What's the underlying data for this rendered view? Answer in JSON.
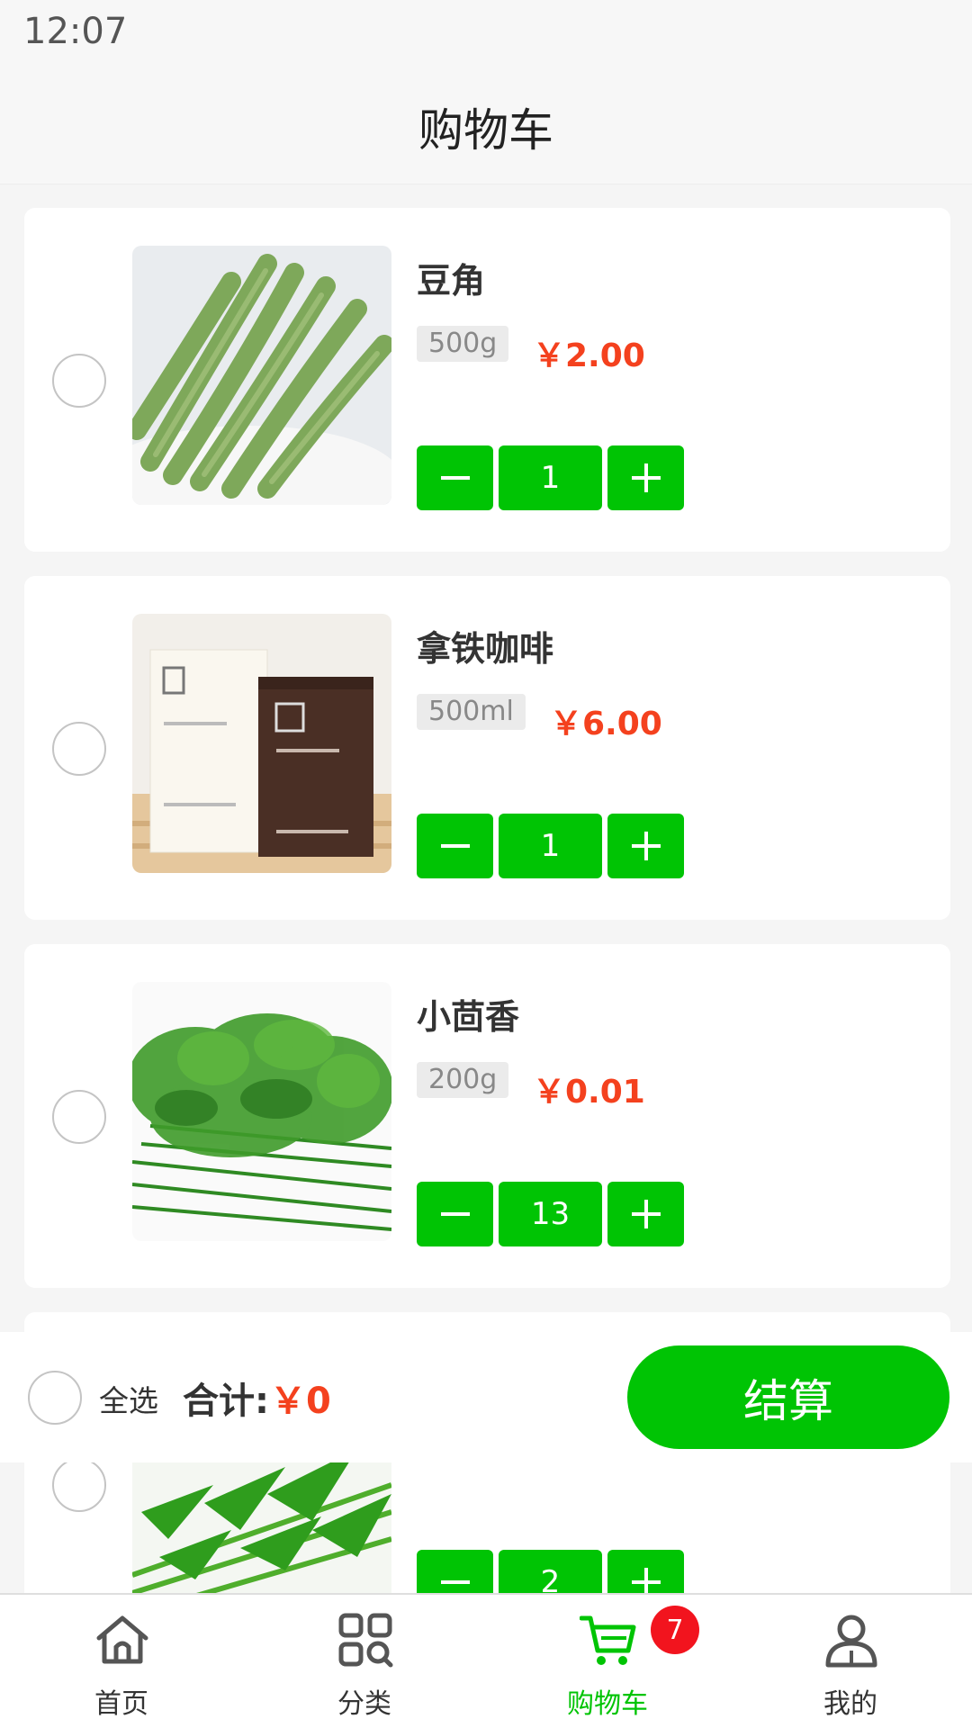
{
  "status_bar": {
    "time": "12:07"
  },
  "header": {
    "title": "购物车"
  },
  "colors": {
    "accent": "#00c404",
    "price": "#f4411e",
    "badge": "#f2141e"
  },
  "cart": {
    "items": [
      {
        "name": "豆角",
        "spec": "500g",
        "price": "￥2.00",
        "quantity": "1",
        "checked": false,
        "image": "green-beans"
      },
      {
        "name": "拿铁咖啡",
        "spec": "500ml",
        "price": "￥6.00",
        "quantity": "1",
        "checked": false,
        "image": "coffee-cartons"
      },
      {
        "name": "小茴香",
        "spec": "200g",
        "price": "￥0.01",
        "quantity": "13",
        "checked": false,
        "image": "fennel"
      },
      {
        "quantity": "2",
        "checked": false,
        "image": "water-spinach"
      }
    ]
  },
  "stepper": {
    "minus_icon": "minus-icon",
    "plus_icon": "plus-icon"
  },
  "checkout": {
    "select_all_label": "全选",
    "total_label": "合计:",
    "total_value": "￥0",
    "button_label": "结算"
  },
  "tabbar": {
    "tabs": [
      {
        "label": "首页",
        "icon": "home-icon"
      },
      {
        "label": "分类",
        "icon": "category-icon"
      },
      {
        "label": "购物车",
        "icon": "cart-icon",
        "active": true,
        "badge": "7"
      },
      {
        "label": "我的",
        "icon": "user-icon"
      }
    ]
  }
}
